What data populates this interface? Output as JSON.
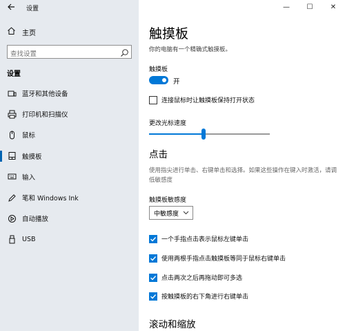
{
  "window": {
    "title": "设置",
    "controls": {
      "minimize": "—",
      "maximize": "☐",
      "close": "✕"
    }
  },
  "sidebar": {
    "home": "主页",
    "search_placeholder": "查找设置",
    "section": "设置",
    "items": [
      {
        "label": "蓝牙和其他设备",
        "icon": "bluetooth-devices-icon"
      },
      {
        "label": "打印机和扫描仪",
        "icon": "printer-icon"
      },
      {
        "label": "鼠标",
        "icon": "mouse-icon"
      },
      {
        "label": "触摸板",
        "icon": "touchpad-icon",
        "active": true
      },
      {
        "label": "输入",
        "icon": "keyboard-icon"
      },
      {
        "label": "笔和 Windows Ink",
        "icon": "pen-icon"
      },
      {
        "label": "自动播放",
        "icon": "autoplay-icon"
      },
      {
        "label": "USB",
        "icon": "usb-icon"
      }
    ]
  },
  "main": {
    "title": "触摸板",
    "subtitle": "你的电脑有一个精确式触摸板。",
    "toggle_label": "触摸板",
    "toggle_state": "开",
    "leave_on_checkbox": "连接鼠标时让触摸板保持打开状态",
    "cursor_speed_label": "更改光标速度",
    "cursor_speed_fraction": 0.45,
    "tap_heading": "点击",
    "tap_desc": "使用指尖进行单击、右键单击和选择。如果这些操作在键入时激活，请调低敏感度",
    "sensitivity_label": "触摸板敏感度",
    "sensitivity_value": "中敏感度",
    "tap_options": [
      "一个手指点击表示鼠标左键单击",
      "使用两根手指点击触摸板等同于鼠标右键单击",
      "点击两次之后再拖动即可多选",
      "按触摸板的右下角进行右键单击"
    ],
    "scroll_heading": "滚动和缩放"
  },
  "colors": {
    "accent": "#0078d7",
    "sidebar_bg": "#e6eaef"
  }
}
